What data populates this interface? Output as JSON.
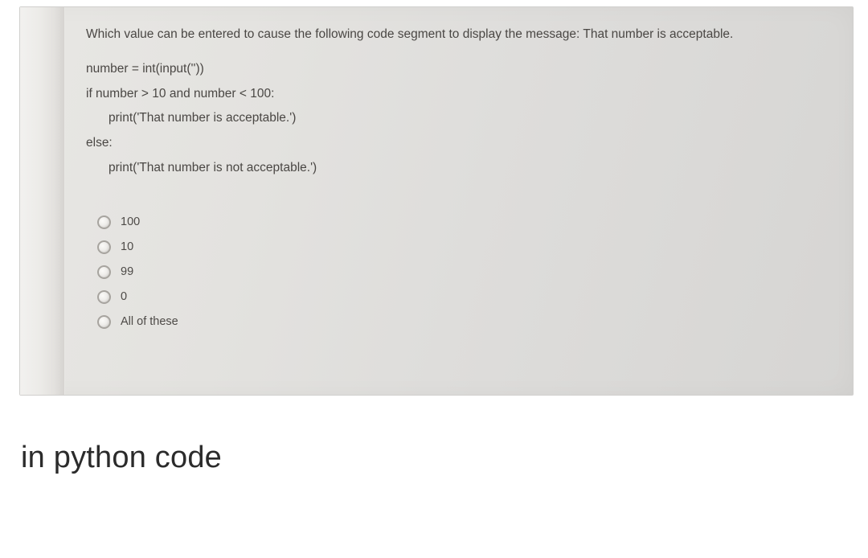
{
  "question": {
    "prompt": "Which value can be entered to cause the following code segment to display the message: That number is acceptable.",
    "code": {
      "l1": "number = int(input(''))",
      "l2": "if number > 10 and number < 100:",
      "l3": "print('That number is acceptable.')",
      "l4": "else:",
      "l5": "print('That number is not acceptable.')"
    },
    "options": [
      {
        "label": "100"
      },
      {
        "label": "10"
      },
      {
        "label": "99"
      },
      {
        "label": "0"
      },
      {
        "label": "All of these"
      }
    ]
  },
  "caption": "in python code"
}
